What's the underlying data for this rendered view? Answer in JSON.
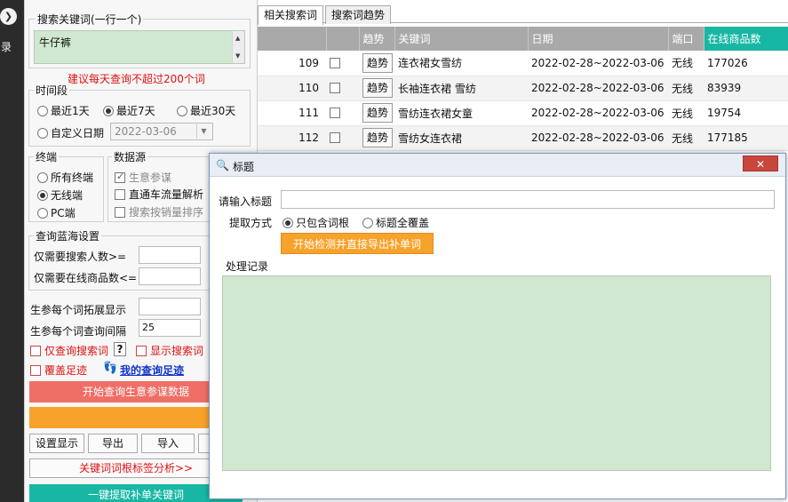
{
  "sidebar": {
    "label": "录"
  },
  "left": {
    "keyword_group_title": "搜索关键词(一行一个)",
    "keyword_value": "牛仔裤",
    "tip": "建议每天查询不超过200个词",
    "period_title": "时间段",
    "period_options": [
      "最近1天",
      "最近7天",
      "最近30天"
    ],
    "custom_date_label": "自定义日期",
    "custom_date_value": "2022-03-06",
    "terminal_title": "终端",
    "terminal_options": [
      "所有终端",
      "无线端",
      "PC端"
    ],
    "source_title": "数据源",
    "source_options": [
      "生意参谋",
      "直通车流量解析",
      "搜索按销量排序"
    ],
    "bluesea_title": "查询蓝海设置",
    "min_search_label": "仅需要搜索人数>=",
    "min_goods_label": "仅需要在线商品数<=",
    "expand_label": "生参每个词拓展显示",
    "interval_label": "生参每个词查询间隔",
    "interval_value": "25",
    "only_search_label": "仅查询搜索词",
    "help_mark": "?",
    "show_search_label": "显示搜索词",
    "cover_label": "覆盖足迹",
    "my_footprint_label": "我的查询足迹",
    "start_button": "开始查询生意参谋数据",
    "second_button": "",
    "settings_button": "设置显示",
    "export_button": "导出",
    "import_button": "导入",
    "analysis_button": "关键词词根标签分析>>",
    "extract_button": "一键提取补单关键词"
  },
  "tabs": [
    "相关搜索词",
    "搜索词趋势"
  ],
  "table": {
    "headers": [
      "",
      "",
      "趋势",
      "关键词",
      "日期",
      "端口",
      "在线商品数"
    ],
    "trend_label": "趋势",
    "rows": [
      {
        "idx": "109",
        "keyword": "连衣裙女雪纺",
        "date": "2022-02-28~2022-03-06",
        "port": "无线",
        "count": "177026"
      },
      {
        "idx": "110",
        "keyword": "长袖连衣裙 雪纺",
        "date": "2022-02-28~2022-03-06",
        "port": "无线",
        "count": "83939"
      },
      {
        "idx": "111",
        "keyword": "雪纺连衣裙女童",
        "date": "2022-02-28~2022-03-06",
        "port": "无线",
        "count": "19754"
      },
      {
        "idx": "112",
        "keyword": "雪纺女连衣裙",
        "date": "2022-02-28~2022-03-06",
        "port": "无线",
        "count": "177185"
      }
    ]
  },
  "dialog": {
    "title": "标题",
    "close": "✕",
    "input_label": "请输入标题",
    "mode_label": "提取方式",
    "mode_options": [
      "只包含词根",
      "标题全覆盖"
    ],
    "start_button": "开始检测并直接导出补单词",
    "log_label": "处理记录"
  },
  "colors": {
    "green_bg": "#cfe8cf",
    "orange": "#f7a22b",
    "red_btn": "#ef6f66",
    "teal": "#18b7a4",
    "header_gray": "#a9a9a9"
  }
}
